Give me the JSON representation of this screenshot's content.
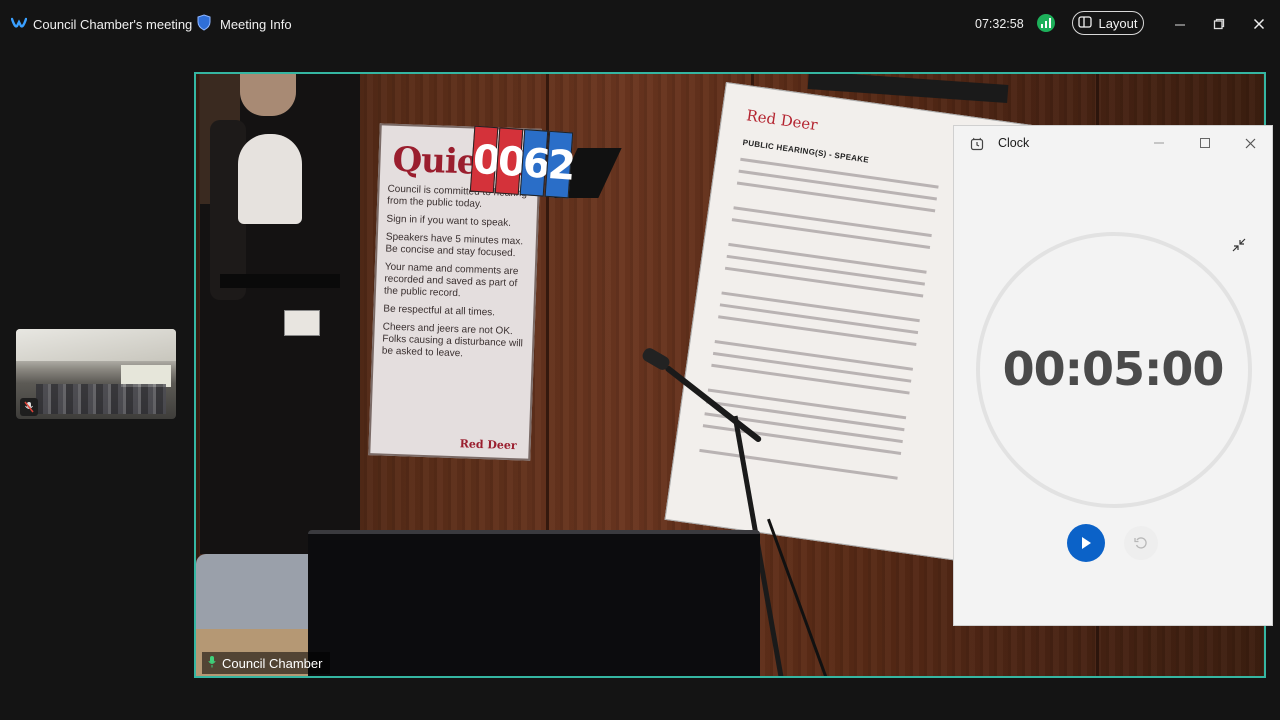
{
  "topbar": {
    "meeting_title": "Council Chamber's meeting",
    "meeting_info_label": "Meeting Info",
    "clock": "07:32:58",
    "layout_label": "Layout"
  },
  "video": {
    "participant_name": "Council Chamber",
    "scene": {
      "sign_title": "Quiet Z",
      "sign_lines": [
        "Council is committed to hearing from the public today.",
        "Sign in if you want to speak.",
        "Speakers have 5 minutes max. Be concise and stay focused.",
        "Your name and comments are recorded and saved as part of the public record.",
        "Be respectful at all times.",
        "Cheers and jeers are not OK. Folks causing a disturbance will be asked to leave."
      ],
      "sign_logo": "Red Deer",
      "counter_digits": [
        "0",
        "0",
        "6",
        "2"
      ],
      "easel_logo": "Red Deer",
      "easel_heading": "PUBLIC HEARING(S) - SPEAKE"
    }
  },
  "clock_app": {
    "title": "Clock",
    "timer": "00:05:00"
  },
  "colors": {
    "active_speaker_border": "#35b6a2",
    "play_button": "#0b62c8",
    "signal_ok": "#1db05a"
  }
}
